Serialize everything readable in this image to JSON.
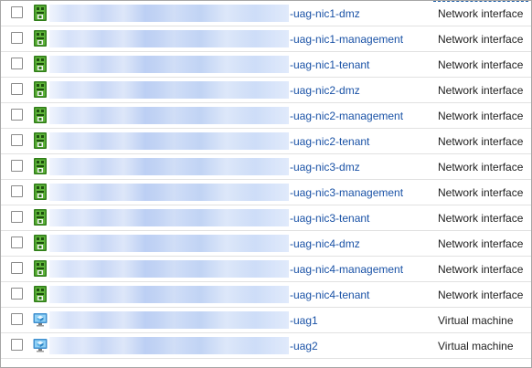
{
  "rows": [
    {
      "name": "-uag-nic1-dmz",
      "type": "Network interface",
      "icon": "network-interface-icon"
    },
    {
      "name": "-uag-nic1-management",
      "type": "Network interface",
      "icon": "network-interface-icon"
    },
    {
      "name": "-uag-nic1-tenant",
      "type": "Network interface",
      "icon": "network-interface-icon"
    },
    {
      "name": "-uag-nic2-dmz",
      "type": "Network interface",
      "icon": "network-interface-icon"
    },
    {
      "name": "-uag-nic2-management",
      "type": "Network interface",
      "icon": "network-interface-icon"
    },
    {
      "name": "-uag-nic2-tenant",
      "type": "Network interface",
      "icon": "network-interface-icon"
    },
    {
      "name": "-uag-nic3-dmz",
      "type": "Network interface",
      "icon": "network-interface-icon"
    },
    {
      "name": "-uag-nic3-management",
      "type": "Network interface",
      "icon": "network-interface-icon"
    },
    {
      "name": "-uag-nic3-tenant",
      "type": "Network interface",
      "icon": "network-interface-icon"
    },
    {
      "name": "-uag-nic4-dmz",
      "type": "Network interface",
      "icon": "network-interface-icon"
    },
    {
      "name": "-uag-nic4-management",
      "type": "Network interface",
      "icon": "network-interface-icon"
    },
    {
      "name": "-uag-nic4-tenant",
      "type": "Network interface",
      "icon": "network-interface-icon"
    },
    {
      "name": "-uag1",
      "type": "Virtual machine",
      "icon": "virtual-machine-icon"
    },
    {
      "name": "-uag2",
      "type": "Virtual machine",
      "icon": "virtual-machine-icon"
    }
  ],
  "colors": {
    "link": "#1a52a6",
    "nic_green": "#3a8a1f",
    "vm_blue": "#5ab0e6"
  }
}
